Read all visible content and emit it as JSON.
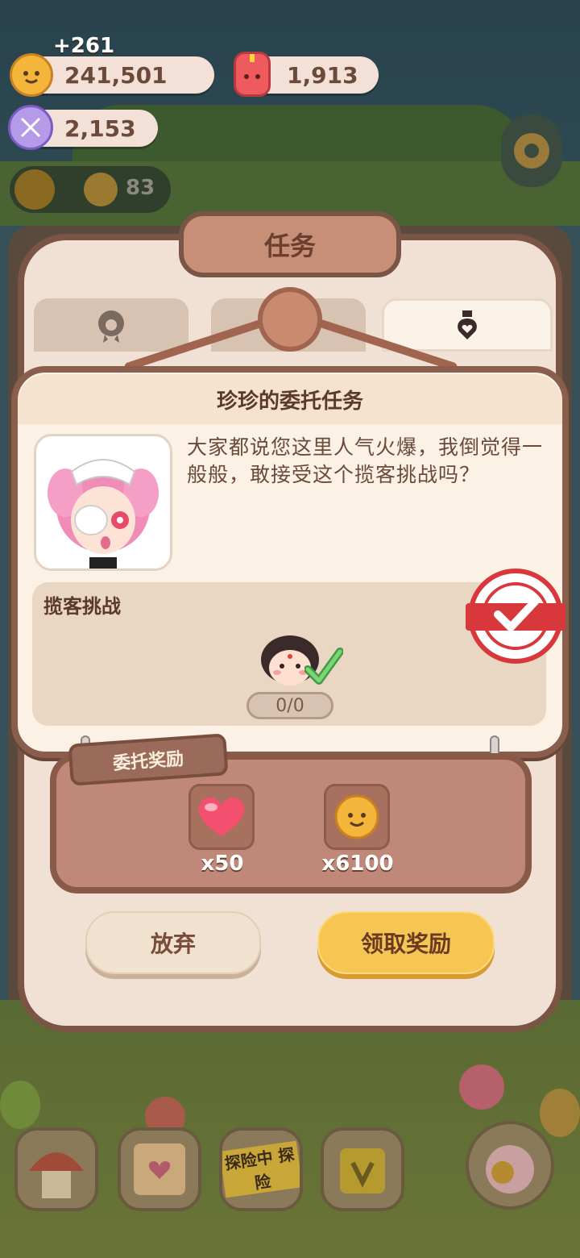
{
  "currencies": {
    "gain": "+261",
    "cookies": "241,501",
    "candles": "1,913",
    "candy": "2,153",
    "village_count": "83"
  },
  "task_window": {
    "title": "任务",
    "tabs": [
      {
        "icon": "badge-paw-icon",
        "active": false
      },
      {
        "icon": "blank-tab",
        "active": false
      },
      {
        "icon": "bottle-heart-icon",
        "active": true
      }
    ]
  },
  "dialog": {
    "title": "珍珍的委托任务",
    "message": "大家都说您这里人气火爆，我倒觉得一般般，敢接受这个揽客挑战吗？",
    "challenge_label": "揽客挑战",
    "progress": "0/0",
    "status": "completed"
  },
  "rewards": {
    "label": "委托奖励",
    "items": [
      {
        "icon": "heart-icon",
        "qty": "x50"
      },
      {
        "icon": "cookie-icon",
        "qty": "x6100"
      }
    ]
  },
  "buttons": {
    "abandon": "放弃",
    "claim": "领取奖励"
  },
  "bottom_nav": {
    "adventure_text": "探险中 探险"
  },
  "colors": {
    "panel": "#fbf1e4",
    "frame": "#8a5e4d",
    "claim_button": "#f6c654",
    "stamp_red": "#d8383c"
  }
}
